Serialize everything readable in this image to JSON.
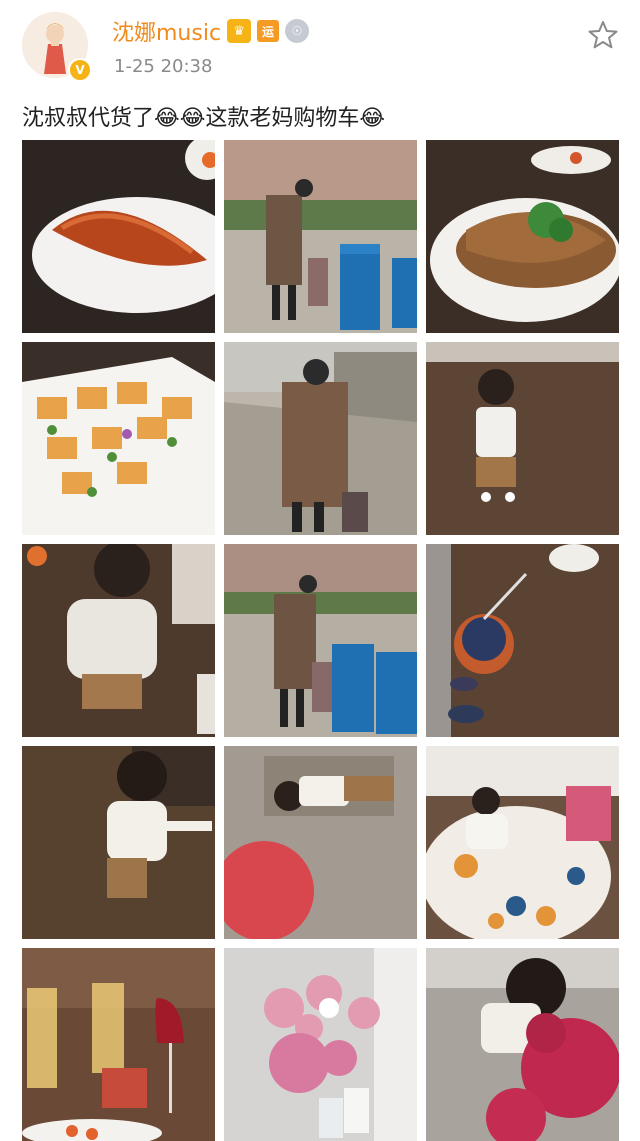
{
  "post": {
    "username": "沈娜music",
    "badges": [
      "vip-crown-icon",
      "运",
      "medal-icon"
    ],
    "timestamp": "1-25 20:38",
    "verified_icon": "verified-v-icon",
    "text": "沈叔叔代货了😂😂这款老妈购物车😂"
  },
  "colors": {
    "username": "#f08a1c",
    "timestamp": "#8a8a8a",
    "badge_gold": "#f5b316"
  },
  "photos": [
    {
      "name": "photo-roast-duck",
      "desc": ""
    },
    {
      "name": "photo-grandpa-cart-bins",
      "desc": ""
    },
    {
      "name": "photo-steamed-fish",
      "desc": ""
    },
    {
      "name": "photo-canape-plate",
      "desc": ""
    },
    {
      "name": "photo-grandpa-walking",
      "desc": ""
    },
    {
      "name": "photo-toddler-floor",
      "desc": ""
    },
    {
      "name": "photo-toddler-back",
      "desc": ""
    },
    {
      "name": "photo-grandpa-bins-2",
      "desc": ""
    },
    {
      "name": "photo-toddler-toy-cart",
      "desc": ""
    },
    {
      "name": "photo-toddler-standing",
      "desc": ""
    },
    {
      "name": "photo-baby-lying-ball",
      "desc": ""
    },
    {
      "name": "photo-toddler-rug",
      "desc": ""
    },
    {
      "name": "photo-wine-glasses",
      "desc": ""
    },
    {
      "name": "photo-flower-vase",
      "desc": ""
    },
    {
      "name": "photo-toddler-plush",
      "desc": ""
    }
  ]
}
